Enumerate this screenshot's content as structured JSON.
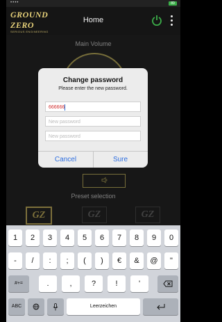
{
  "status": {
    "dots": "••••",
    "battery": "89"
  },
  "header": {
    "logo_text": "GROUND ZERO",
    "logo_subtitle": "SERIOUS ENGINEERING",
    "title": "Home"
  },
  "main": {
    "volume_label": "Main Volume",
    "preset_label": "Preset selection",
    "presets": [
      "GZ",
      "GZ",
      "GZ"
    ]
  },
  "dialog": {
    "title": "Change password",
    "message": "Please enter the new password.",
    "field1_value": "666666",
    "field2_placeholder": "New password",
    "field3_placeholder": "New password",
    "cancel": "Cancel",
    "confirm": "Sure"
  },
  "keyboard": {
    "row1": [
      "1",
      "2",
      "3",
      "4",
      "5",
      "6",
      "7",
      "8",
      "9",
      "0"
    ],
    "row2": [
      "-",
      "/",
      ":",
      ";",
      "(",
      ")",
      "€",
      "&",
      "@",
      "\""
    ],
    "shift": "#+=",
    "row3": [
      ".",
      ",",
      "?",
      "!",
      "'"
    ],
    "abc": "ABC",
    "space": "Leerzeichen"
  },
  "colors": {
    "accent_gold": "#d9c86a",
    "power_green": "#3cb04a",
    "ios_blue": "#2f6fe0",
    "field_text": "#d02a2a"
  },
  "icons": [
    "power-icon",
    "menu-icon",
    "speaker-icon",
    "backspace-icon",
    "globe-icon",
    "mic-icon",
    "return-icon"
  ]
}
